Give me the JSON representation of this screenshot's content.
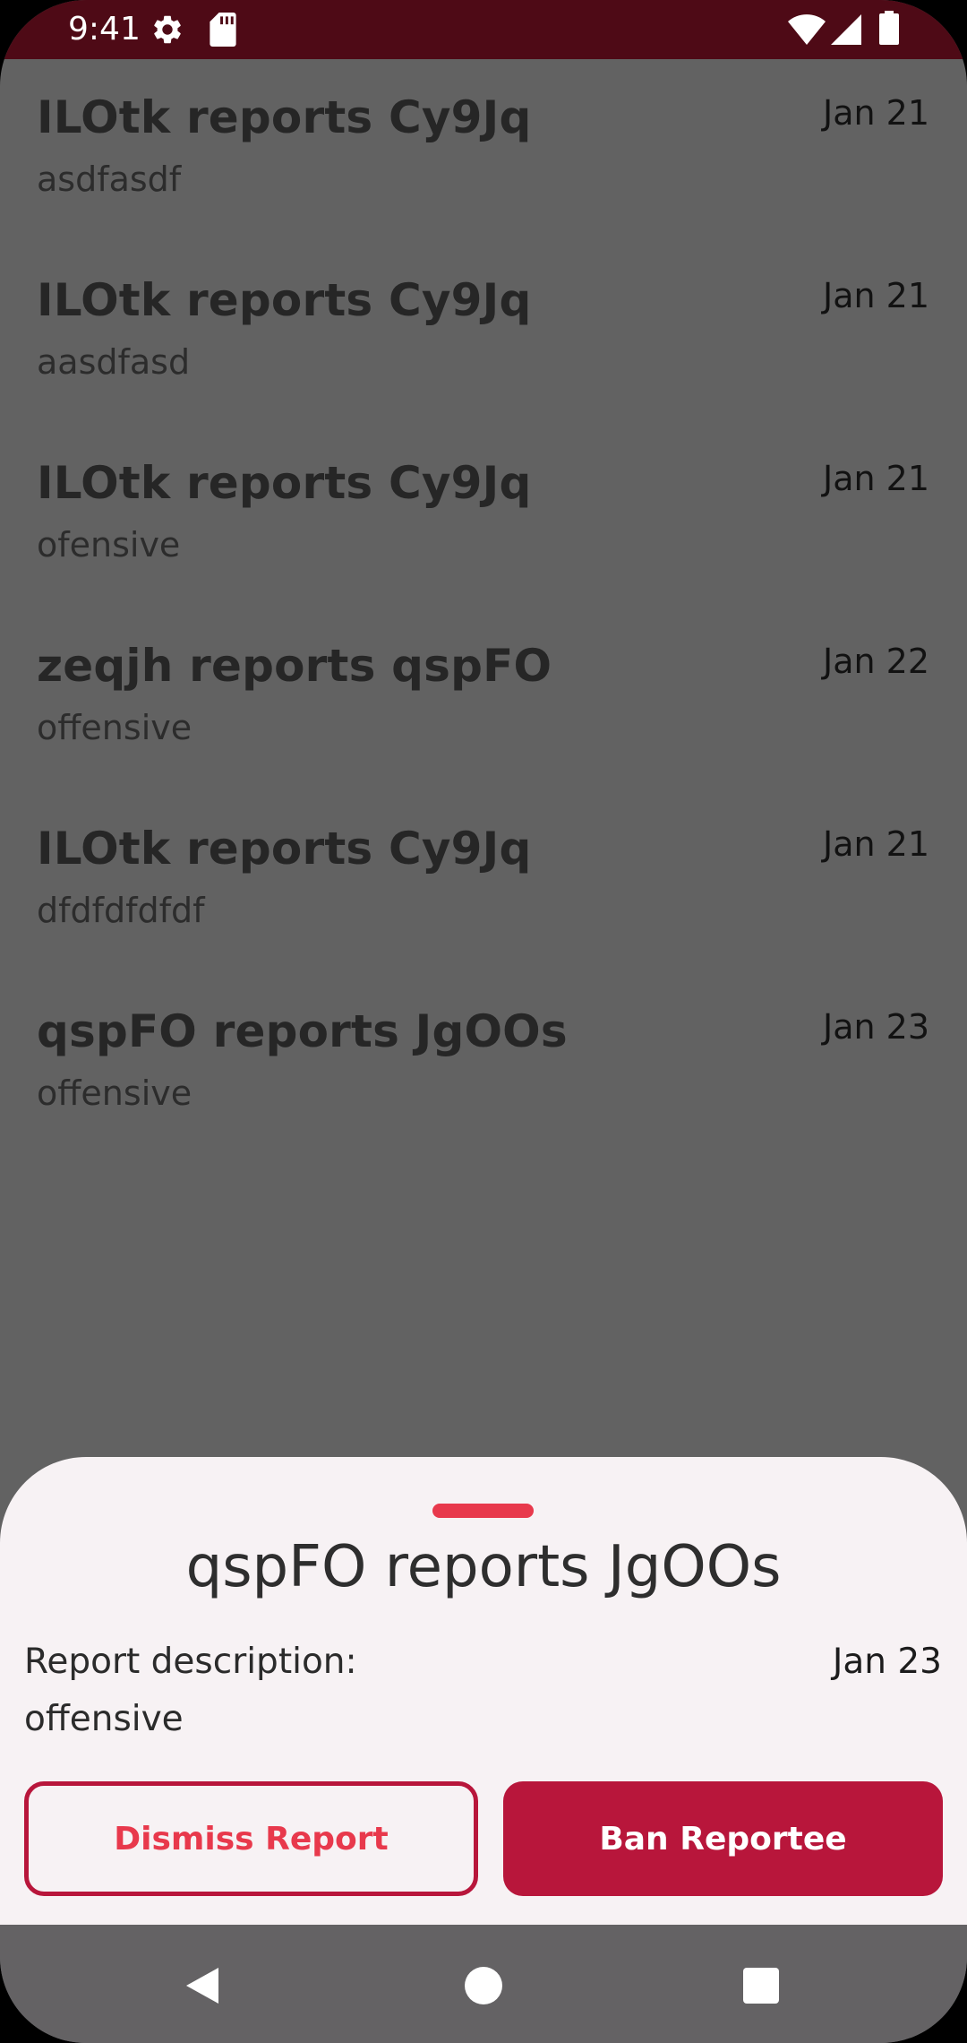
{
  "status_bar": {
    "time": "9:41",
    "icons": [
      "gear-icon",
      "sd-card-icon",
      "wifi-icon",
      "cell-signal-icon",
      "battery-icon"
    ],
    "background": "#4e0a16"
  },
  "reports": [
    {
      "title": "ILOtk reports Cy9Jq",
      "date": "Jan 21",
      "description": "asdfasdf"
    },
    {
      "title": "ILOtk reports Cy9Jq",
      "date": "Jan 21",
      "description": "aasdfasd"
    },
    {
      "title": "ILOtk reports Cy9Jq",
      "date": "Jan 21",
      "description": "ofensive"
    },
    {
      "title": "zeqjh reports qspFO",
      "date": "Jan 22",
      "description": "offensive"
    },
    {
      "title": "ILOtk reports Cy9Jq",
      "date": "Jan 21",
      "description": "dfdfdfdfdf"
    },
    {
      "title": "qspFO reports JgOOs",
      "date": "Jan 23",
      "description": "offensive"
    }
  ],
  "sheet": {
    "title": "qspFO reports JgOOs",
    "description_label": "Report description:",
    "date": "Jan 23",
    "description": "offensive",
    "dismiss_label": "Dismiss Report",
    "ban_label": "Ban Reportee"
  },
  "nav_bar": {
    "icons": [
      "back-icon",
      "home-icon",
      "recents-icon"
    ]
  },
  "colors": {
    "accent": "#b8163b",
    "accent_light": "#e8394c",
    "scrim": "#626262",
    "sheet_background": "#f7f2f4"
  }
}
